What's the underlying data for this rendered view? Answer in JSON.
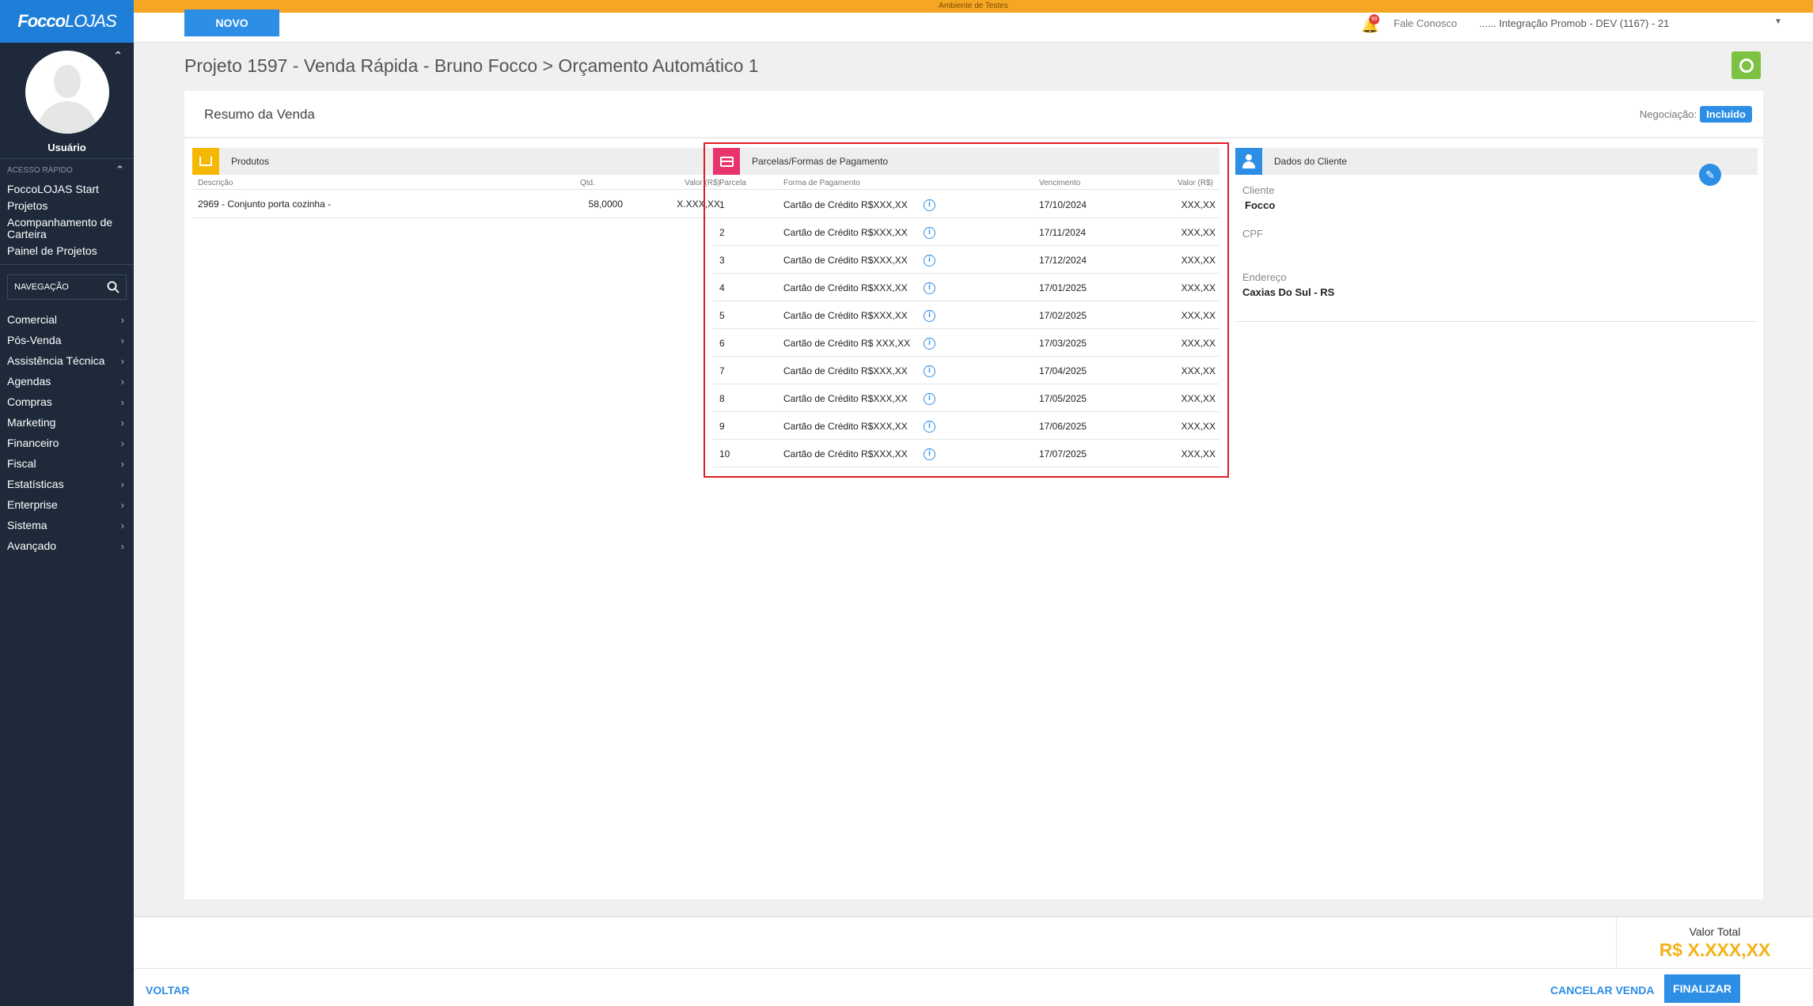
{
  "app": {
    "logo_a": "Focco",
    "logo_b": "LOJAS",
    "env_label": "Ambiente de Testes"
  },
  "sidebar": {
    "username": "Usuário",
    "quick_title": "ACESSO RÁPIDO",
    "quick": [
      "FoccoLOJAS Start",
      "Projetos",
      "Acompanhamento de Carteira",
      "Painel de Projetos"
    ],
    "search_placeholder": "NAVEGAÇÃO",
    "nav": [
      "Comercial",
      "Pós-Venda",
      "Assistência Técnica",
      "Agendas",
      "Compras",
      "Marketing",
      "Financeiro",
      "Fiscal",
      "Estatísticas",
      "Enterprise",
      "Sistema",
      "Avançado"
    ]
  },
  "topbar": {
    "novo": "NOVO",
    "notif_count": "99",
    "fale": "Fale Conosco",
    "empresa": "...... Integração Promob - DEV (1167) - 21"
  },
  "page": {
    "title": "Projeto 1597 - Venda Rápida - Bruno Focco > Orçamento Automático 1"
  },
  "resumo": {
    "title": "Resumo da Venda",
    "negociacao_label": "Negociação:",
    "negociacao_status": "Incluído"
  },
  "produtos": {
    "title": "Produtos",
    "headers": {
      "descricao": "Descrição",
      "qtd": "Qtd.",
      "valor": "Valor (R$)"
    },
    "rows": [
      {
        "descricao": "2969 - Conjunto porta cozinha -",
        "qtd": "58,0000",
        "valor": "X.XXX,XX"
      }
    ]
  },
  "parcelas": {
    "title": "Parcelas/Formas de Pagamento",
    "headers": {
      "parcela": "Parcela",
      "forma": "Forma de Pagamento",
      "vencimento": "Vencimento",
      "valor": "Valor (R$)"
    },
    "rows": [
      {
        "n": "1",
        "forma": "Cartão de Crédito R$XXX,XX",
        "venc": "17/10/2024",
        "valor": "XXX,XX"
      },
      {
        "n": "2",
        "forma": "Cartão de Crédito R$XXX,XX",
        "venc": "17/11/2024",
        "valor": "XXX,XX"
      },
      {
        "n": "3",
        "forma": "Cartão de Crédito R$XXX,XX",
        "venc": "17/12/2024",
        "valor": "XXX,XX"
      },
      {
        "n": "4",
        "forma": "Cartão de Crédito R$XXX,XX",
        "venc": "17/01/2025",
        "valor": "XXX,XX"
      },
      {
        "n": "5",
        "forma": "Cartão de Crédito R$XXX,XX",
        "venc": "17/02/2025",
        "valor": "XXX,XX"
      },
      {
        "n": "6",
        "forma": "Cartão de Crédito R$ XXX,XX",
        "venc": "17/03/2025",
        "valor": "XXX,XX"
      },
      {
        "n": "7",
        "forma": "Cartão de Crédito R$XXX,XX",
        "venc": "17/04/2025",
        "valor": "XXX,XX"
      },
      {
        "n": "8",
        "forma": "Cartão de Crédito R$XXX,XX",
        "venc": "17/05/2025",
        "valor": "XXX,XX"
      },
      {
        "n": "9",
        "forma": "Cartão de Crédito R$XXX,XX",
        "venc": "17/06/2025",
        "valor": "XXX,XX"
      },
      {
        "n": "10",
        "forma": "Cartão de Crédito R$XXX,XX",
        "venc": "17/07/2025",
        "valor": "XXX,XX"
      }
    ]
  },
  "cliente": {
    "title": "Dados do Cliente",
    "cliente_label": "Cliente",
    "cliente_val": "Focco",
    "cpf_label": "CPF",
    "cpf_val": "",
    "endereco_label": "Endereço",
    "endereco_val": "Caxias Do Sul - RS"
  },
  "footer": {
    "total_label": "Valor Total",
    "total_val": "R$ X.XXX,XX",
    "voltar": "VOLTAR",
    "cancelar": "CANCELAR VENDA",
    "finalizar": "FINALIZAR"
  },
  "colors": {
    "primary": "#2d8ee6",
    "sidebar": "#1e2a3a",
    "env": "#f5a623",
    "produtos": "#f5b800",
    "parcelas": "#e8336b",
    "total": "#f2b31b",
    "green": "#7dc242",
    "highlight": "#e01b24"
  }
}
